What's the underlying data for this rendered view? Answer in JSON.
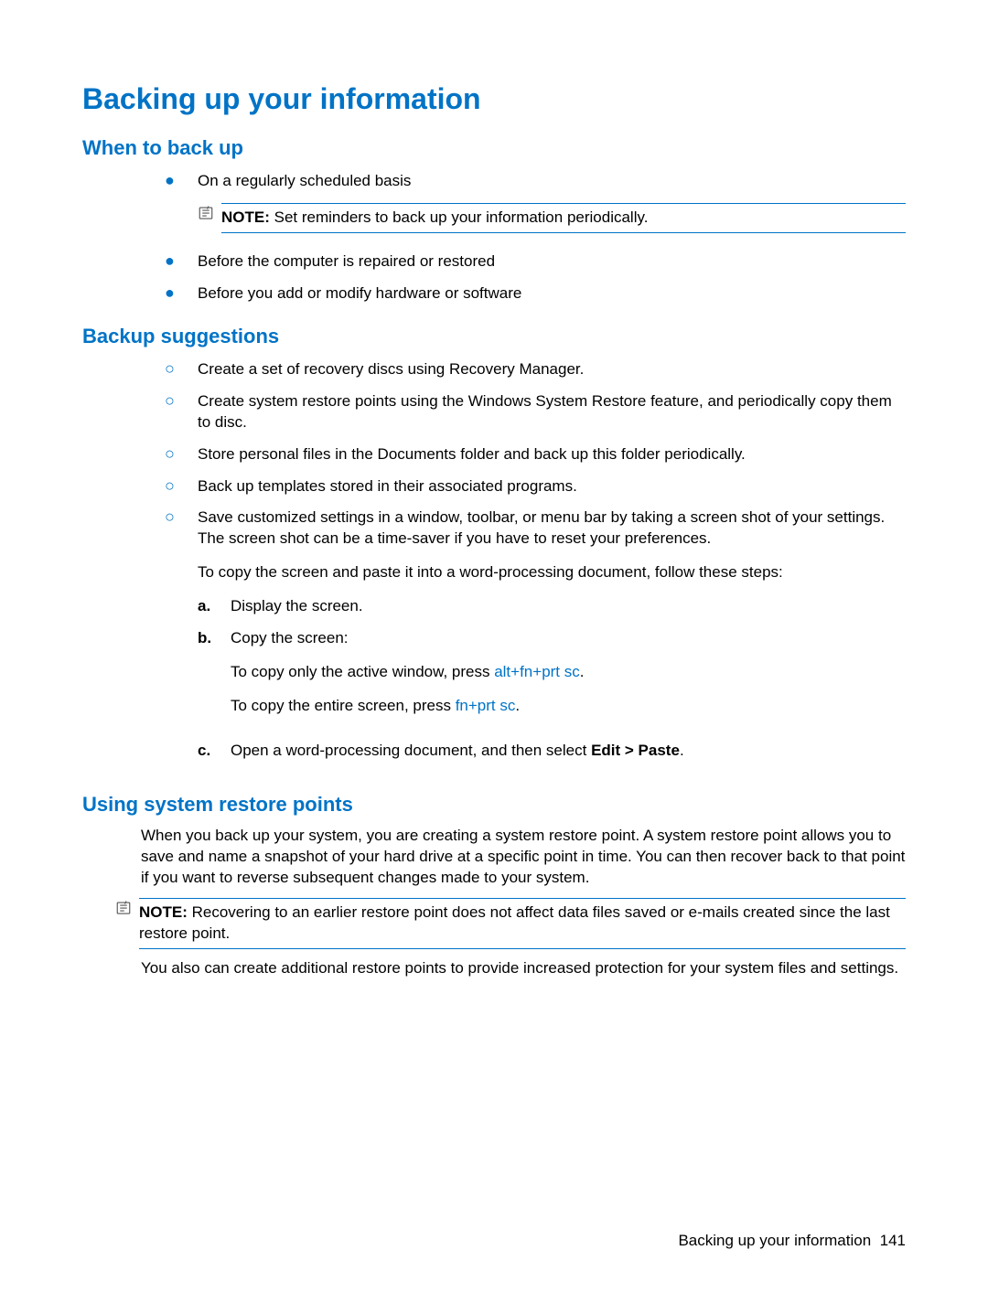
{
  "title": "Backing up your information",
  "sections": {
    "when": {
      "heading": "When to back up",
      "items": [
        "On a regularly scheduled basis",
        "Before the computer is repaired or restored",
        "Before you add or modify hardware or software"
      ],
      "note": {
        "label": "NOTE:",
        "text": "Set reminders to back up your information periodically."
      }
    },
    "suggestions": {
      "heading": "Backup suggestions",
      "items": [
        "Create a set of recovery discs using Recovery Manager.",
        "Create system restore points using the Windows System Restore feature, and periodically copy them to disc.",
        "Store personal files in the Documents folder and back up this folder periodically.",
        "Back up templates stored in their associated programs.",
        "Save customized settings in a window, toolbar, or menu bar by taking a screen shot of your settings. The screen shot can be a time-saver if you have to reset your preferences."
      ],
      "item5_extra": "To copy the screen and paste it into a word-processing document, follow these steps:",
      "steps": {
        "a": {
          "marker": "a.",
          "text": "Display the screen."
        },
        "b": {
          "marker": "b.",
          "text": "Copy the screen:",
          "sub1_pre": "To copy only the active window, press ",
          "sub1_kbd": "alt+fn+prt sc",
          "sub2_pre": "To copy the entire screen, press ",
          "sub2_kbd": "fn+prt sc"
        },
        "c": {
          "marker": "c.",
          "pre": "Open a word-processing document, and then select ",
          "bold": "Edit > Paste",
          "post": "."
        }
      }
    },
    "restore": {
      "heading": "Using system restore points",
      "para1": "When you back up your system, you are creating a system restore point. A system restore point allows you to save and name a snapshot of your hard drive at a specific point in time. You can then recover back to that point if you want to reverse subsequent changes made to your system.",
      "note": {
        "label": "NOTE:",
        "text": "Recovering to an earlier restore point does not affect data files saved or e-mails created since the last restore point."
      },
      "para2": "You also can create additional restore points to provide increased protection for your system files and settings."
    }
  },
  "footer": {
    "text": "Backing up your information",
    "page": "141"
  }
}
